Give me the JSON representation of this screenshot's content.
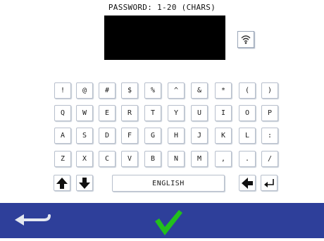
{
  "header": {
    "title": "PASSWORD: 1-20 (CHARS)"
  },
  "keyboard": {
    "rows": [
      [
        "!",
        "@",
        "#",
        "$",
        "%",
        "^",
        "&",
        "*",
        "(",
        ")"
      ],
      [
        "Q",
        "W",
        "E",
        "R",
        "T",
        "Y",
        "U",
        "I",
        "O",
        "P"
      ],
      [
        "A",
        "S",
        "D",
        "F",
        "G",
        "H",
        "J",
        "K",
        "L",
        ":"
      ],
      [
        "Z",
        "X",
        "C",
        "V",
        "B",
        "N",
        "M",
        ",",
        ".",
        "/"
      ]
    ],
    "language_label": "ENGLISH"
  },
  "icons": {
    "visibility": "wifi-icon",
    "shift_up": "up-arrow-icon",
    "shift_down": "down-arrow-icon",
    "backspace": "left-arrow-icon",
    "enter": "enter-return-icon",
    "back": "back-return-icon",
    "confirm": "checkmark-icon"
  },
  "colors": {
    "bottom_bar": "#2e3f9a",
    "confirm": "#22c01c",
    "display": "#000000"
  }
}
